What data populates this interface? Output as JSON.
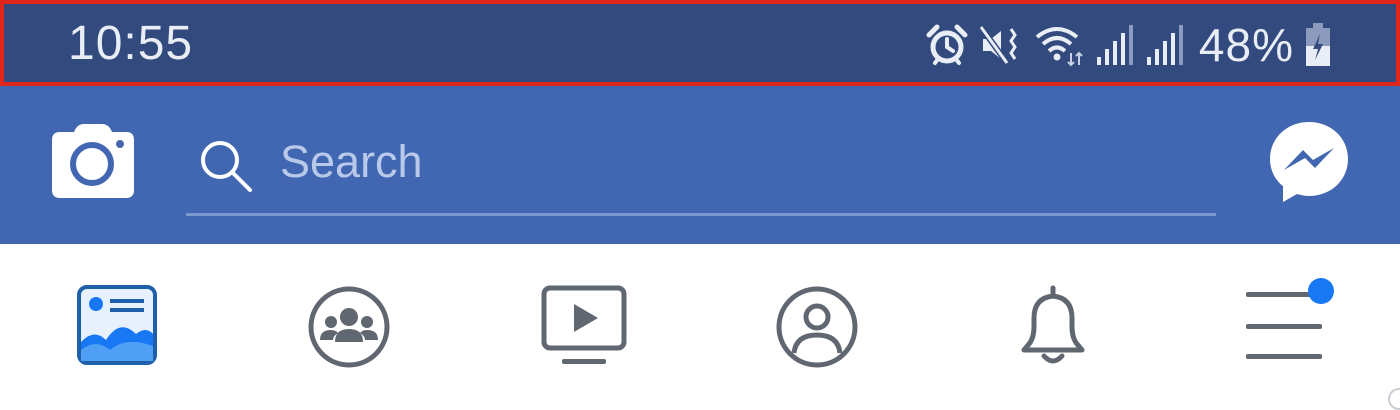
{
  "status_bar": {
    "time": "10:55",
    "battery_percent": "48%",
    "icons": [
      "alarm-icon",
      "vibrate-mute-icon",
      "wifi-icon",
      "signal-icon",
      "signal-icon",
      "battery-charging-icon"
    ]
  },
  "header": {
    "search_placeholder": "Search",
    "icons": [
      "camera-icon",
      "search-icon",
      "messenger-icon"
    ]
  },
  "nav": {
    "tabs": [
      {
        "name": "news-feed",
        "icon": "news-feed-icon",
        "active": true
      },
      {
        "name": "groups",
        "icon": "groups-icon",
        "active": false
      },
      {
        "name": "watch",
        "icon": "watch-icon",
        "active": false
      },
      {
        "name": "profile",
        "icon": "profile-icon",
        "active": false
      },
      {
        "name": "notifications",
        "icon": "bell-icon",
        "active": false
      },
      {
        "name": "menu",
        "icon": "menu-icon",
        "active": false,
        "has_badge": true
      }
    ]
  },
  "colors": {
    "status_bar": "#324a7e",
    "status_border": "#e0251c",
    "header": "#4267b2",
    "nav_icon": "#606770",
    "badge": "#1877f2"
  }
}
